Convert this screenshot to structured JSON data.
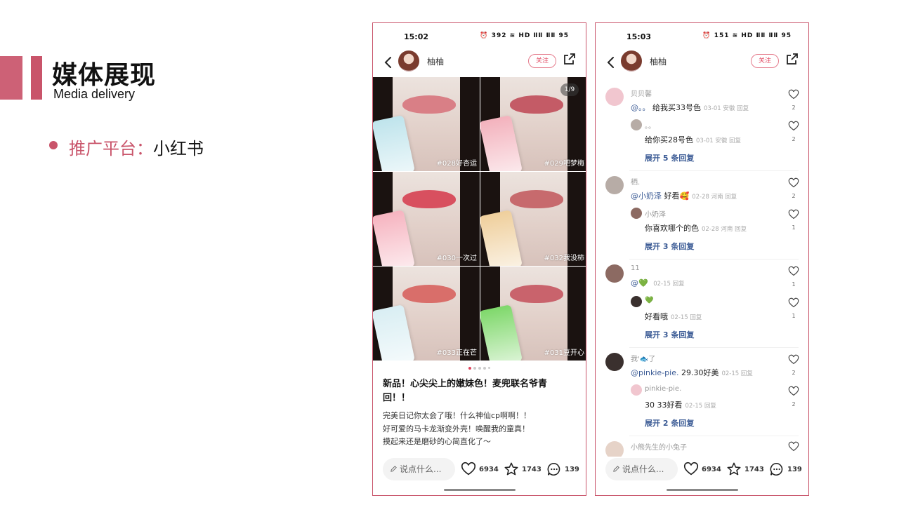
{
  "slide": {
    "title": "媒体展现",
    "subtitle": "Media delivery",
    "bullet_label": "推广平台：",
    "bullet_value": "小红书",
    "accent_color": "#c9546a"
  },
  "phone1": {
    "time": "15:02",
    "status_icons": "⏰ 392 ≋ HD ⅡⅡ ⅡⅡ 95",
    "user_name": "柚柚",
    "follow_label": "关注",
    "image_counter": "1/9",
    "images": [
      {
        "label": "#028好杏运",
        "lip": "#d97f86",
        "tube": "#bfe4ec"
      },
      {
        "label": "#029吧梦梅",
        "lip": "#c45b66",
        "tube": "#f3b2bd"
      },
      {
        "label": "#030一次过",
        "lip": "#d8505f",
        "tube": "#f6b4c0"
      },
      {
        "label": "#032我没柿",
        "lip": "#c76a6d",
        "tube": "#efcf9c"
      },
      {
        "label": "#033正在芒",
        "lip": "#d96e6a",
        "tube": "#d9eef3"
      },
      {
        "label": "#031豆开心",
        "lip": "#c9636c",
        "tube": "#7fd86b"
      }
    ],
    "post_title": "新品！心尖尖上的嫩妹色！麦兜联名爷青回！！",
    "post_body": [
      "完美日记你太会了哦！什么神仙cp啊啊！！",
      "好可爱的马卡龙渐变外壳！唤醒我的童真！",
      "摸起来还是磨砂的心简直化了～"
    ],
    "comment_placeholder": "说点什么...",
    "likes": "6934",
    "favorites": "1743",
    "comments": "139"
  },
  "phone2": {
    "time": "15:03",
    "status_icons": "⏰ 151 ≋ HD ⅡⅡ ⅡⅡ 95",
    "user_name": "柚柚",
    "follow_label": "关注",
    "threads": [
      {
        "name": "贝贝馨",
        "mention": "@。。",
        "text": "给我买33号色",
        "meta": "03-01 安徽 回复",
        "likes": "2",
        "reply_name": "。。",
        "reply_text": "给你买28号色",
        "reply_meta": "03-01 安徽 回复",
        "reply_likes": "2",
        "expand": "展开 5 条回复"
      },
      {
        "name": "栖.",
        "mention": "@小奶泽",
        "text": "好看🥰",
        "meta": "02-28 河南 回复",
        "likes": "2",
        "reply_name": "小奶泽",
        "reply_text": "你喜欢哪个的色",
        "reply_meta": "02-28 河南 回复",
        "reply_likes": "1",
        "expand": "展开 3 条回复"
      },
      {
        "name": "11",
        "mention": "@💚",
        "text": "",
        "meta": "02-15 回复",
        "likes": "1",
        "reply_name": "💚",
        "reply_text": "好看哦",
        "reply_meta": "02-15 回复",
        "reply_likes": "1",
        "expand": "展开 3 条回复"
      },
      {
        "name": "我'🐟了",
        "mention": "@pinkie-pie.",
        "text": "29.30好美",
        "meta": "02-15 回复",
        "likes": "2",
        "reply_name": "pinkie-pie.",
        "reply_text": "30 33好看",
        "reply_meta": "02-15 回复",
        "reply_likes": "2",
        "expand": "展开 2 条回复"
      }
    ],
    "last_name": "小熊先生的小兔子",
    "comment_placeholder": "说点什么...",
    "likes": "6934",
    "favorites": "1743",
    "comments": "139"
  }
}
